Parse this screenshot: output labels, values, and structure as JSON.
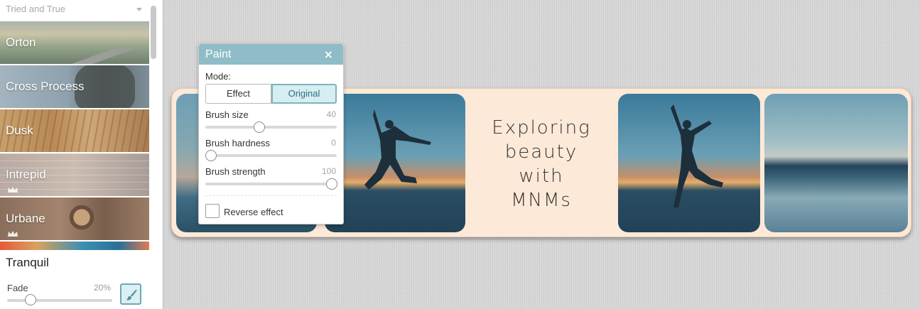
{
  "sidebar": {
    "category": "Tried and True",
    "effects": [
      {
        "label": "Orton"
      },
      {
        "label": "Cross Process"
      },
      {
        "label": "Dusk"
      },
      {
        "label": "Intrepid"
      },
      {
        "label": "Urbane"
      }
    ],
    "selected_effect": "Tranquil",
    "fade": {
      "label": "Fade",
      "value": "20%"
    }
  },
  "paint_dialog": {
    "title": "Paint",
    "close_glyph": "×",
    "mode_label": "Mode:",
    "modes": {
      "effect": "Effect",
      "original": "Original"
    },
    "active_mode": "Original",
    "brush_size": {
      "label": "Brush size",
      "value": "40"
    },
    "brush_hardness": {
      "label": "Brush hardness",
      "value": "0"
    },
    "brush_strength": {
      "label": "Brush strength",
      "value": "100"
    },
    "reverse_effect": {
      "label": "Reverse effect",
      "checked": false
    }
  },
  "collage": {
    "caption_lines": [
      "Exploring",
      "beauty",
      "with",
      "MNMs"
    ]
  },
  "colors": {
    "dialog_header": "#8ebcc7",
    "accent": "#7cb3c0",
    "collage_background": "#fde9d8"
  },
  "icons": {
    "close": "close-icon",
    "paintbrush": "paintbrush-icon",
    "crown": "crown-icon",
    "dropdown": "chevron-down-icon"
  }
}
